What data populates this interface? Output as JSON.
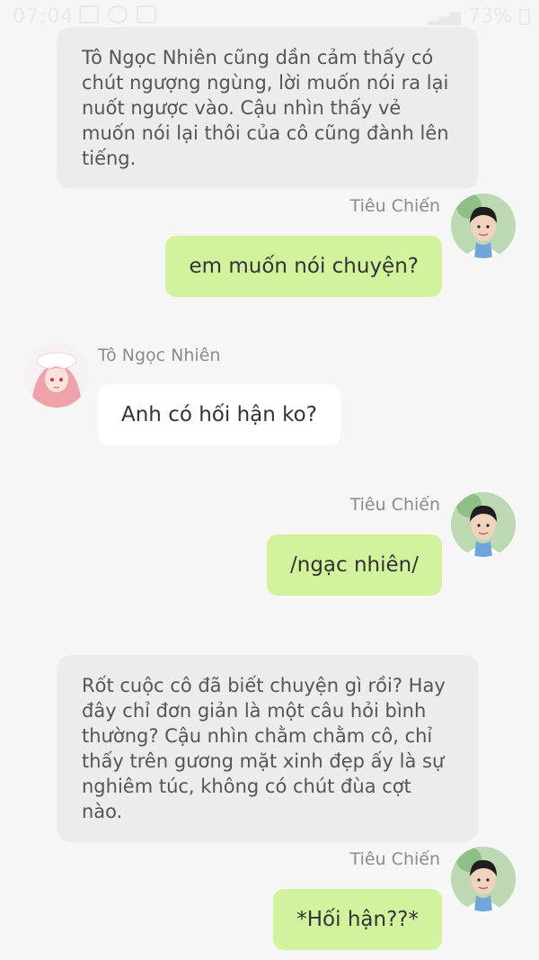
{
  "status_bar": {
    "time": "07:04",
    "battery": "73%"
  },
  "messages": [
    {
      "type": "narration",
      "text": "Tô Ngọc Nhiên cũng dần cảm thấy có chút ngượng ngùng, lời muốn nói ra lại nuốt ngược vào. Cậu nhìn thấy vẻ muốn nói lại thôi của cô cũng đành lên tiếng."
    },
    {
      "type": "outgoing",
      "sender": "Tiêu Chiến",
      "text": "em muốn nói chuyện?"
    },
    {
      "type": "incoming",
      "sender": "Tô Ngọc Nhiên",
      "text": "Anh có hối hận ko?"
    },
    {
      "type": "outgoing",
      "sender": "Tiêu Chiến",
      "text": "/ngạc nhiên/"
    },
    {
      "type": "narration",
      "text": "Rốt cuộc cô đã biết chuyện gì rồi? Hay đây chỉ đơn giản là một câu hỏi bình thường? Cậu nhìn chằm chằm cô, chỉ thấy trên gương mặt xinh đẹp ấy là sự nghiêm túc, không có chút đùa cợt nào."
    },
    {
      "type": "outgoing",
      "sender": "Tiêu Chiến",
      "text": "*Hối hận??*"
    }
  ],
  "colors": {
    "outgoing_bubble": "#d2f29e",
    "incoming_bubble": "#ffffff",
    "narration_bg": "#ececec",
    "background": "#f6f6f6"
  }
}
